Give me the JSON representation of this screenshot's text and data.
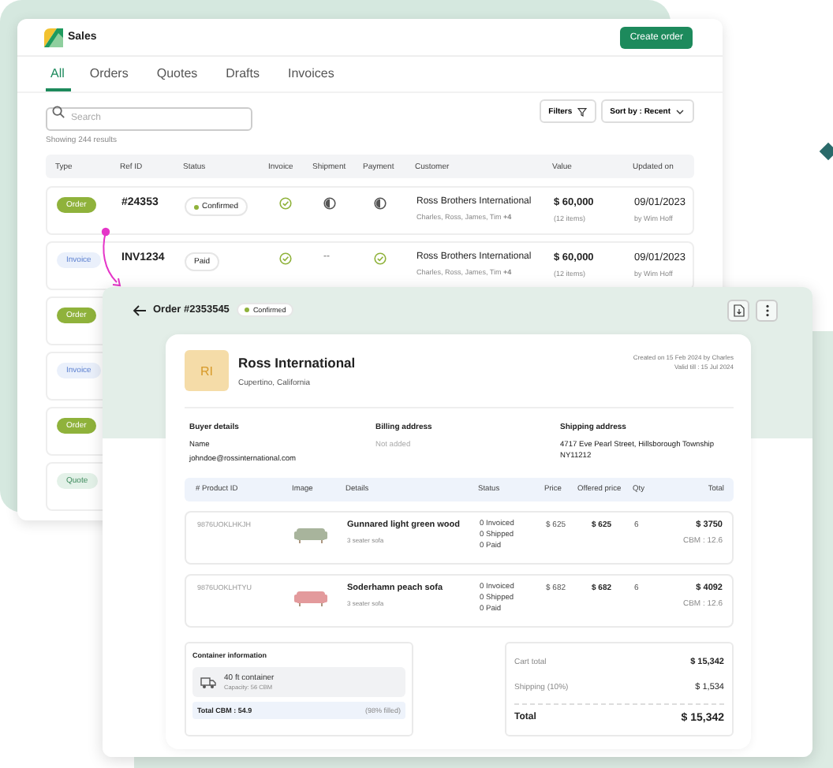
{
  "app": {
    "title": "Sales",
    "create_button": "Create order"
  },
  "tabs": [
    {
      "label": "All",
      "selected": true
    },
    {
      "label": "Orders",
      "selected": false
    },
    {
      "label": "Quotes",
      "selected": false
    },
    {
      "label": "Drafts",
      "selected": false
    },
    {
      "label": "Invoices",
      "selected": false
    }
  ],
  "search": {
    "placeholder": "Search"
  },
  "filters_button": "Filters",
  "sort_button": "Sort by : Recent",
  "results_text": "Showing 244 results",
  "orders_table": {
    "columns": [
      "Type",
      "Ref ID",
      "Status",
      "Invoice",
      "Shipment",
      "Payment",
      "Customer",
      "Value",
      "Updated on"
    ],
    "rows": [
      {
        "type": {
          "label": "Order",
          "kind": "order"
        },
        "ref_id": "#24353",
        "status": {
          "label": "Confirmed",
          "dot": true
        },
        "invoice": {
          "kind": "check"
        },
        "shipment": {
          "kind": "half"
        },
        "payment": {
          "kind": "half"
        },
        "customer": "Ross Brothers International",
        "contacts": "Charles, Ross, James, Tim **+4**",
        "value": "$ 60,000",
        "items": "(12 items)",
        "updated_on": "09/01/2023",
        "updated_by": "by Wim Hoff"
      },
      {
        "type": {
          "label": "Invoice",
          "kind": "invoice"
        },
        "ref_id": "INV1234",
        "status": {
          "label": "Paid",
          "dot": false
        },
        "invoice": {
          "kind": "check"
        },
        "shipment": {
          "kind": "text",
          "text": "--"
        },
        "payment": {
          "kind": "check"
        },
        "customer": "Ross Brothers International",
        "contacts": "Charles, Ross, James, Tim **+4**",
        "value": "$ 60,000",
        "items": "(12 items)",
        "updated_on": "09/01/2023",
        "updated_by": "by Wim Hoff"
      },
      {
        "type": {
          "label": "Order",
          "kind": "order"
        }
      },
      {
        "type": {
          "label": "Invoice",
          "kind": "invoice"
        }
      },
      {
        "type": {
          "label": "Order",
          "kind": "order"
        }
      },
      {
        "type": {
          "label": "Quote",
          "kind": "quote"
        }
      }
    ]
  },
  "order_detail": {
    "title": "Order #2353545",
    "status": {
      "label": "Confirmed",
      "dot": true
    },
    "customer": {
      "initials": "RI",
      "name": "Ross International",
      "location": "Cupertino, California"
    },
    "created": "Created on 15 Feb 2024 by Charles",
    "valid": "Valid till : 15 Jul 2024",
    "buyer": {
      "heading": "Buyer details",
      "name_label": "Name",
      "email": "johndoe@rossinternational.com"
    },
    "billing": {
      "heading": "Billing address",
      "value": "Not added"
    },
    "shipping": {
      "heading": "Shipping address",
      "value": "4717 Eve Pearl Street, Hillsborough Township NY11212"
    },
    "products": {
      "columns": [
        "# Product ID",
        "Image",
        "Details",
        "Status",
        "Price",
        "Offered price",
        "Qty",
        "Total"
      ],
      "rows": [
        {
          "product_id": "9876UOKLHKJH",
          "color": "#a8b49c",
          "name": "Gunnared light green wood",
          "description": "3 seater sofa",
          "status": [
            "0 Invoiced",
            "0 Shipped",
            "0 Paid"
          ],
          "price": "$ 625",
          "offered_price": "$ 625",
          "qty": "6",
          "total": "$ 3750",
          "cbm": "CBM : 12.6"
        },
        {
          "product_id": "9876UOKLHTYU",
          "color": "#e39a9c",
          "name": "Soderhamn peach sofa",
          "description": "3 seater sofa",
          "status": [
            "0 Invoiced",
            "0 Shipped",
            "0 Paid"
          ],
          "price": "$ 682",
          "offered_price": "$ 682",
          "qty": "6",
          "total": "$ 4092",
          "cbm": "CBM : 12.6"
        }
      ]
    },
    "container": {
      "heading": "Container information",
      "name": "40 ft container",
      "capacity": "Capacity: 56 CBM",
      "total_cbm": "Total CBM : 54.9",
      "filled": "(98% filled)"
    },
    "totals": {
      "cart_label": "Cart total",
      "cart_value": "$ 15,342",
      "shipping_label": "Shipping (10%)",
      "shipping_value": "$ 1,534",
      "total_label": "Total",
      "total_value": "$ 15,342"
    }
  }
}
